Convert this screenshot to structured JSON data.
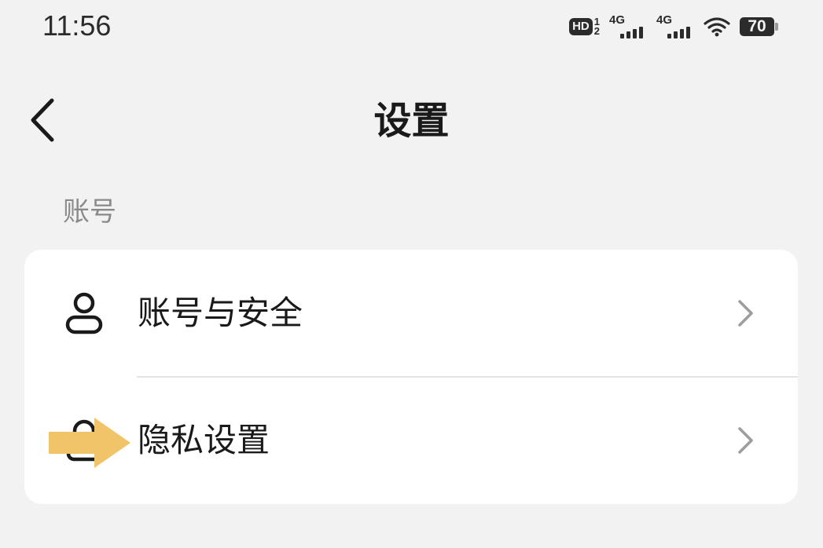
{
  "status_bar": {
    "time": "11:56",
    "hd_label": "HD",
    "hd_sim_top": "1",
    "hd_sim_bottom": "2",
    "sim1_network": "4G",
    "sim2_network": "4G",
    "wifi_icon": "wifi-icon",
    "battery_level": "70"
  },
  "nav": {
    "title": "设置",
    "back_icon": "chevron-left-icon"
  },
  "section": {
    "header": "账号",
    "items": [
      {
        "label": "账号与安全",
        "icon": "user-icon"
      },
      {
        "label": "隐私设置",
        "icon": "lock-icon"
      }
    ]
  },
  "overlay": {
    "pointer_icon": "arrow-right-icon",
    "pointer_color": "#f2c46a"
  },
  "colors": {
    "background": "#f2f2f2",
    "card": "#ffffff",
    "text_primary": "#1a1a1a",
    "text_secondary": "#8a8a8a",
    "chevron": "#9e9e9e"
  }
}
